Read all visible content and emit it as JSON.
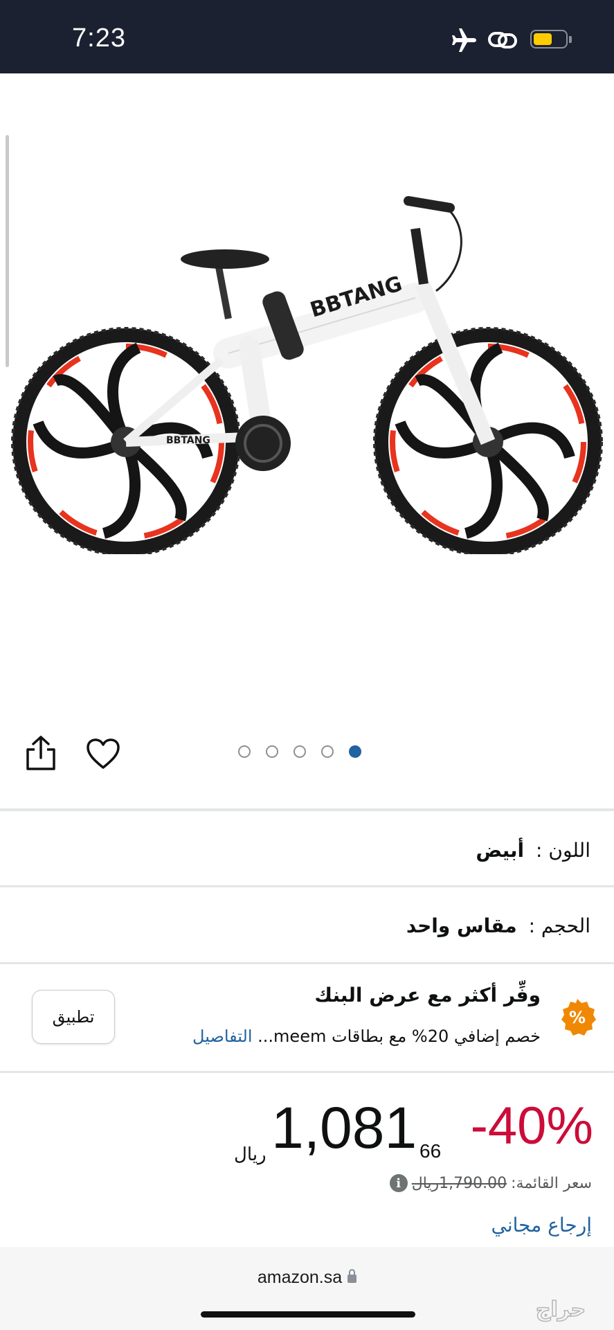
{
  "status_bar": {
    "time": "7:23",
    "icons": [
      "airplane-icon",
      "link-icon",
      "battery-icon"
    ],
    "battery_color": "#ffcc00"
  },
  "product_image": {
    "brand_text": "BBTANG",
    "carousel_total": 5,
    "carousel_active": 5,
    "accent_color": "#e8331e"
  },
  "actions": {
    "icons": [
      "share-icon",
      "heart-icon"
    ]
  },
  "color_row": {
    "label": "اللون :",
    "value": "أبيض"
  },
  "size_row": {
    "label": "الحجم :",
    "value": "مقاس واحد"
  },
  "bank_offer": {
    "title": "وفِّر أكثر مع عرض البنك",
    "description": "خصم إضافي 20% مع بطاقات meem...",
    "details_link": "التفاصيل",
    "apply_label": "تطبيق",
    "badge_text": "%",
    "badge_color": "#f08804"
  },
  "price": {
    "discount": "-40%",
    "whole": "1,081",
    "fraction": "66",
    "currency": "ريال",
    "list_price_label": "سعر القائمة:",
    "list_price_value": "1,790.00ريال",
    "free_returns": "إرجاع مجاني"
  },
  "address_bar": {
    "url": "amazon.sa"
  },
  "watermark": "حراج"
}
